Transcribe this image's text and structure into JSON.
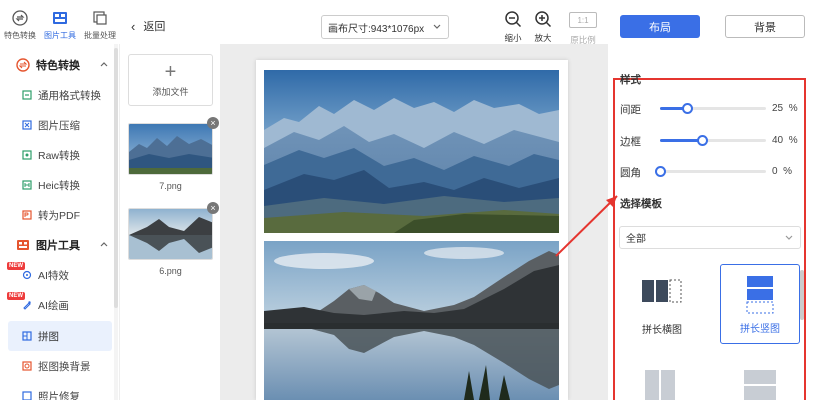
{
  "top_tabs": [
    {
      "label": "特色转换",
      "icon": "convert-icon",
      "active": false
    },
    {
      "label": "图片工具",
      "icon": "image-tools-icon",
      "active": true
    },
    {
      "label": "批量处理",
      "icon": "batch-icon",
      "active": false
    }
  ],
  "sidebar": {
    "sections": [
      {
        "label": "特色转换",
        "icon": "convert-icon",
        "expanded": true
      },
      {
        "label": "图片工具",
        "icon": "image-tools-icon",
        "expanded": true
      }
    ],
    "items": [
      {
        "label": "通用格式转换",
        "icon": "format-icon"
      },
      {
        "label": "图片压缩",
        "icon": "compress-icon"
      },
      {
        "label": "Raw转换",
        "icon": "raw-icon"
      },
      {
        "label": "Heic转换",
        "icon": "heic-icon"
      },
      {
        "label": "转为PDF",
        "icon": "pdf-icon"
      },
      {
        "label": "AI特效",
        "icon": "ai-effect-icon",
        "badge": "NEW"
      },
      {
        "label": "AI绘画",
        "icon": "ai-paint-icon",
        "badge": "NEW"
      },
      {
        "label": "拼图",
        "icon": "collage-icon",
        "active": true
      },
      {
        "label": "抠图换背景",
        "icon": "cutout-icon"
      },
      {
        "label": "照片修复",
        "icon": "repair-icon"
      }
    ]
  },
  "header": {
    "back_label": "返回",
    "canvas_size": "画布尺寸:943*1076px",
    "zoom_out": "缩小",
    "zoom_in": "放大",
    "ratio_box": "1:1",
    "original_ratio": "原比例"
  },
  "files": {
    "add_label": "添加文件",
    "items": [
      {
        "name": "7.png"
      },
      {
        "name": "6.png"
      }
    ]
  },
  "right_panel": {
    "layout_button": "布局",
    "background_button": "背景",
    "style_heading": "样式",
    "sliders": [
      {
        "label": "间距",
        "value": 25,
        "unit": "%"
      },
      {
        "label": "边框",
        "value": 40,
        "unit": "%"
      },
      {
        "label": "圆角",
        "value": 0,
        "unit": "%"
      }
    ],
    "template_heading": "选择模板",
    "template_filter": "全部",
    "templates": [
      {
        "label": "拼长横图",
        "active": false
      },
      {
        "label": "拼长竖图",
        "active": true
      }
    ]
  },
  "colors": {
    "accent": "#3a6fe6",
    "annotation": "#e5352f",
    "new_badge": "#ee3b3b"
  }
}
